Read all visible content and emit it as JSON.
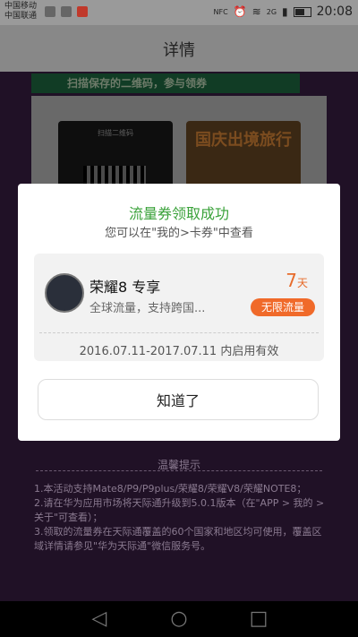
{
  "status_bar": {
    "carrier_1": "中国移动",
    "carrier_2": "中国联通",
    "nfc": "NFC",
    "signal_label": "2G",
    "time": "20:08"
  },
  "app_bar": {
    "title": "详情"
  },
  "background": {
    "banner_text": "扫描保存的二维码，参与领券",
    "qr_title": "扫描二维码",
    "poster_text": "国庆出境旅行"
  },
  "dialog": {
    "title": "流量券领取成功",
    "subtitle": "您可以在\"我的>卡券\"中查看",
    "coupon": {
      "name": "荣耀8 专享",
      "description": "全球流量，支持跨国...",
      "days_value": "7",
      "days_unit": "天",
      "badge": "无限流量",
      "validity": "2016.07.11-2017.07.11 内启用有效"
    },
    "confirm_button": "知道了"
  },
  "tips": {
    "title": "温馨提示",
    "items": [
      "1.本活动支持Mate8/P9/P9plus/荣耀8/荣耀V8/荣耀NOTE8；",
      "2.请在华为应用市场将天际通升级到5.0.1版本（在\"APP > 我的 > 关于\"可查看）；",
      "3.领取的流量券在天际通覆盖的60个国家和地区均可使用，覆盖区域详情请参见\"华为天际通\"微信服务号。"
    ]
  },
  "nav": {
    "back": "◁",
    "home": "○",
    "recents": "□"
  },
  "colors": {
    "accent_green": "#3aa23a",
    "accent_orange": "#f06a2a",
    "background_purple": "#3b1f45"
  }
}
